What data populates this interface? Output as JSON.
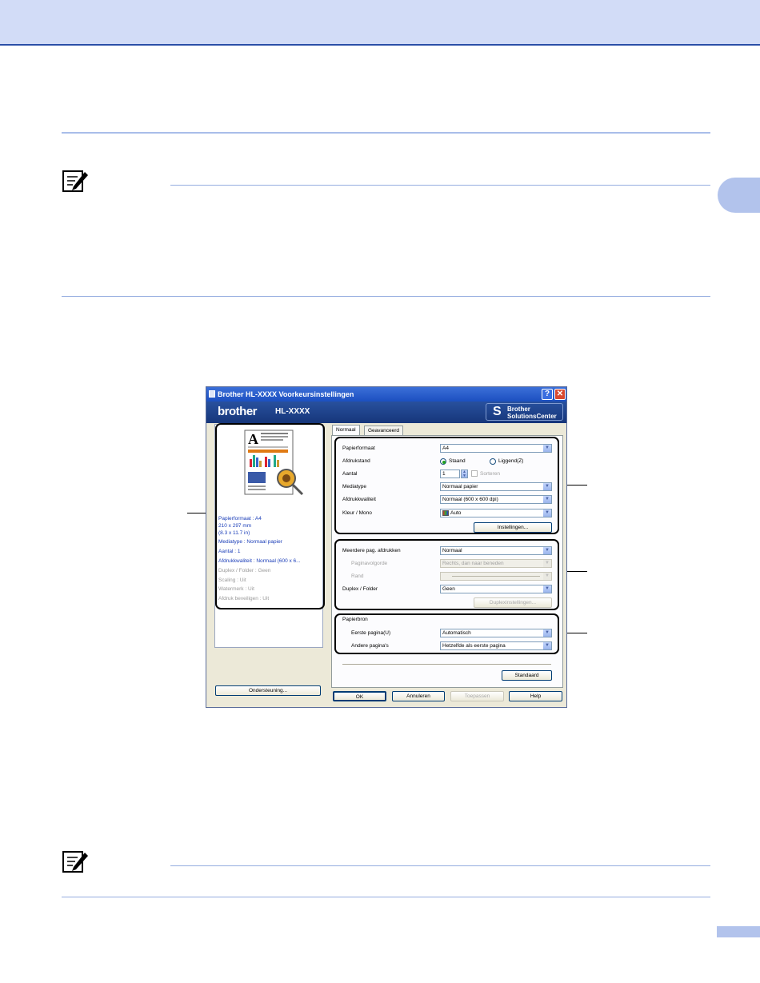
{
  "dialog": {
    "title": "Brother HL-XXXX Voorkeursinstellingen",
    "help_btn": "?",
    "close_btn": "✕",
    "brand": "brother",
    "model": "HL-XXXX",
    "solutions_line1": "Brother",
    "solutions_line2": "SolutionsCenter",
    "preview_letter": "A",
    "info": [
      "Papierformaat : A4",
      "210 x 297 mm",
      "(8.3 x 11.7 in)",
      "Mediatype : Normaal papier",
      "Aantal : 1",
      "Afdrukkwaliteit : Normaal (600 x 6...",
      "Duplex / Folder : Geen",
      "Scaling : Uit",
      "Watermerk : Uit",
      "Afdruk beveiligen : Uit"
    ],
    "support_btn": "Ondersteuning...",
    "tabs": [
      "Normaal",
      "Geavanceerd"
    ],
    "paper_size_label": "Papierformaat",
    "paper_size_value": "A4",
    "orientation_label": "Afdrukstand",
    "portrait": "Staand",
    "landscape": "Liggend(Z)",
    "copies_label": "Aantal",
    "copies_value": "1",
    "collate": "Sorteren",
    "media_label": "Mediatype",
    "media_value": "Normaal papier",
    "quality_label": "Afdrukkwaliteit",
    "quality_value": "Normaal (600 x 600 dpi)",
    "color_label": "Kleur / Mono",
    "color_value": "Auto",
    "settings_btn": "Instellingen...",
    "multi_page_label": "Meerdere pag. afdrukken",
    "multi_page_value": "Normaal",
    "page_order_label": "Paginavolgorde",
    "page_order_value": "Rechts, dan naar beneden",
    "border_label": "Rand",
    "duplex_label": "Duplex / Folder",
    "duplex_value": "Geen",
    "duplex_settings_btn": "Duplexinstellingen...",
    "paper_source_label": "Papierbron",
    "first_page_label": "Eerste pagina(U)",
    "first_page_value": "Automatisch",
    "other_pages_label": "Andere pagina's",
    "other_pages_value": "Hetzelfde als eerste pagina",
    "default_btn": "Standaard",
    "ok_btn": "OK",
    "cancel_btn": "Annuleren",
    "apply_btn": "Toepassen",
    "help_button": "Help"
  }
}
